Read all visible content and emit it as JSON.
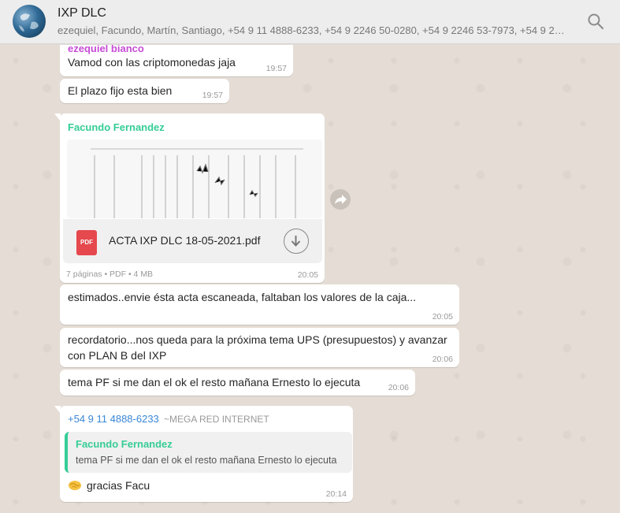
{
  "header": {
    "title": "IXP DLC",
    "participants": "ezequiel, Facundo, Martín, Santiago, +54 9 11 4888-6233, +54 9 2246 50-0280, +54 9 2246 53-7973, +54 9 22…",
    "search_icon": "search-icon"
  },
  "messages": [
    {
      "sender": "ezequiel bianco",
      "sender_color": "#c74ad6",
      "text": "Vamod con las criptomonedas jaja",
      "time": "19:57"
    },
    {
      "text": "El plazo fijo esta bien",
      "time": "19:57"
    },
    {
      "sender": "Facundo Fernandez",
      "sender_color": "#35cd96",
      "document": {
        "name": "ACTA IXP DLC 18-05-2021.pdf",
        "icon_label": "PDF",
        "meta": "7 páginas • PDF • 4 MB"
      },
      "time": "20:05"
    },
    {
      "text": "estimados..envie ésta acta escaneada, faltaban los valores de la caja...",
      "time": "20:05"
    },
    {
      "text_line1": "recordatorio...nos queda para la próxima tema UPS (presupuestos) y avanzar",
      "text_line2": "con PLAN B del IXP",
      "time": "20:06"
    },
    {
      "text": "tema PF si me dan el ok el resto mañana Ernesto lo ejecuta",
      "time": "20:06"
    },
    {
      "sender_phone": "+54 9 11 4888-6233",
      "sender_alias": "~MEGA RED INTERNET",
      "sender_color": "#3a87d6",
      "quote": {
        "sender": "Facundo Fernandez",
        "text": "tema PF si me dan el ok el resto mañana Ernesto lo ejecuta"
      },
      "emoji": "handshake-icon",
      "text": "gracias Facu",
      "time": "20:14"
    }
  ],
  "colors": {
    "chat_bg": "#e5ddd5",
    "bubble": "#ffffff",
    "header_bg": "#ededed"
  }
}
